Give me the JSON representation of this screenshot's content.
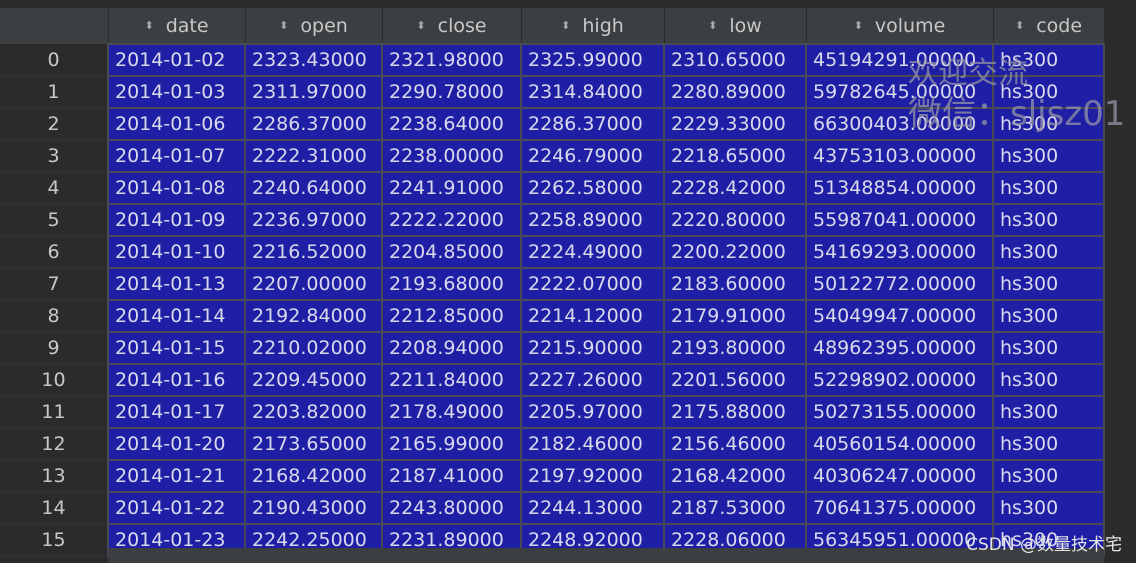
{
  "table": {
    "columns": [
      "date",
      "open",
      "close",
      "high",
      "low",
      "volume",
      "code"
    ],
    "sort_icon": "sort-icon",
    "rows": [
      {
        "index": "0",
        "date": "2014-01-02",
        "open": "2323.43000",
        "close": "2321.98000",
        "high": "2325.99000",
        "low": "2310.65000",
        "volume": "45194291.00000",
        "code": "hs300"
      },
      {
        "index": "1",
        "date": "2014-01-03",
        "open": "2311.97000",
        "close": "2290.78000",
        "high": "2314.84000",
        "low": "2280.89000",
        "volume": "59782645.00000",
        "code": "hs300"
      },
      {
        "index": "2",
        "date": "2014-01-06",
        "open": "2286.37000",
        "close": "2238.64000",
        "high": "2286.37000",
        "low": "2229.33000",
        "volume": "66300403.00000",
        "code": "hs300"
      },
      {
        "index": "3",
        "date": "2014-01-07",
        "open": "2222.31000",
        "close": "2238.00000",
        "high": "2246.79000",
        "low": "2218.65000",
        "volume": "43753103.00000",
        "code": "hs300"
      },
      {
        "index": "4",
        "date": "2014-01-08",
        "open": "2240.64000",
        "close": "2241.91000",
        "high": "2262.58000",
        "low": "2228.42000",
        "volume": "51348854.00000",
        "code": "hs300"
      },
      {
        "index": "5",
        "date": "2014-01-09",
        "open": "2236.97000",
        "close": "2222.22000",
        "high": "2258.89000",
        "low": "2220.80000",
        "volume": "55987041.00000",
        "code": "hs300"
      },
      {
        "index": "6",
        "date": "2014-01-10",
        "open": "2216.52000",
        "close": "2204.85000",
        "high": "2224.49000",
        "low": "2200.22000",
        "volume": "54169293.00000",
        "code": "hs300"
      },
      {
        "index": "7",
        "date": "2014-01-13",
        "open": "2207.00000",
        "close": "2193.68000",
        "high": "2222.07000",
        "low": "2183.60000",
        "volume": "50122772.00000",
        "code": "hs300"
      },
      {
        "index": "8",
        "date": "2014-01-14",
        "open": "2192.84000",
        "close": "2212.85000",
        "high": "2214.12000",
        "low": "2179.91000",
        "volume": "54049947.00000",
        "code": "hs300"
      },
      {
        "index": "9",
        "date": "2014-01-15",
        "open": "2210.02000",
        "close": "2208.94000",
        "high": "2215.90000",
        "low": "2193.80000",
        "volume": "48962395.00000",
        "code": "hs300"
      },
      {
        "index": "10",
        "date": "2014-01-16",
        "open": "2209.45000",
        "close": "2211.84000",
        "high": "2227.26000",
        "low": "2201.56000",
        "volume": "52298902.00000",
        "code": "hs300"
      },
      {
        "index": "11",
        "date": "2014-01-17",
        "open": "2203.82000",
        "close": "2178.49000",
        "high": "2205.97000",
        "low": "2175.88000",
        "volume": "50273155.00000",
        "code": "hs300"
      },
      {
        "index": "12",
        "date": "2014-01-20",
        "open": "2173.65000",
        "close": "2165.99000",
        "high": "2182.46000",
        "low": "2156.46000",
        "volume": "40560154.00000",
        "code": "hs300"
      },
      {
        "index": "13",
        "date": "2014-01-21",
        "open": "2168.42000",
        "close": "2187.41000",
        "high": "2197.92000",
        "low": "2168.42000",
        "volume": "40306247.00000",
        "code": "hs300"
      },
      {
        "index": "14",
        "date": "2014-01-22",
        "open": "2190.43000",
        "close": "2243.80000",
        "high": "2244.13000",
        "low": "2187.53000",
        "volume": "70641375.00000",
        "code": "hs300"
      },
      {
        "index": "15",
        "date": "2014-01-23",
        "open": "2242.25000",
        "close": "2231.89000",
        "high": "2248.92000",
        "low": "2228.06000",
        "volume": "56345951.00000",
        "code": "hs300"
      }
    ]
  },
  "watermark": {
    "line1": "欢迎交流",
    "line2": "微信：sljsz01"
  },
  "credit": "CSDN @数量技术宅",
  "colors": {
    "cell_background": "#1f1fa6",
    "page_background": "#2b2b2b",
    "header_background": "#3c3f41"
  }
}
